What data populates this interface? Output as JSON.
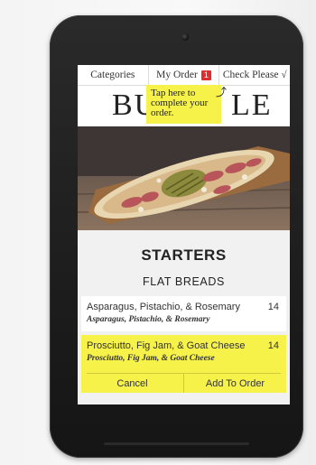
{
  "nav": {
    "categories": "Categories",
    "my_order": "My Order",
    "order_count": "1",
    "check_please": "Check Please",
    "check_mark": "√"
  },
  "logo": {
    "left": "BU",
    "right": "LE"
  },
  "tooltip": {
    "text": "Tap here to complete your order.",
    "arrow": "⤴"
  },
  "menu": {
    "section_title": "STARTERS",
    "subsection_title": "FLAT BREADS",
    "items": [
      {
        "name": "Asparagus, Pistachio, & Rosemary",
        "description": "Asparagus, Pistachio, & Rosemary",
        "price": "14"
      },
      {
        "name": "Prosciutto, Fig Jam, & Goat Cheese",
        "description": "Prosciutto, Fig Jam, & Goat Cheese",
        "price": "14"
      }
    ],
    "actions": {
      "cancel": "Cancel",
      "add": "Add To Order"
    }
  },
  "colors": {
    "highlight": "#f6f24a",
    "badge": "#e02c2c",
    "device": "#1d1d1d"
  }
}
